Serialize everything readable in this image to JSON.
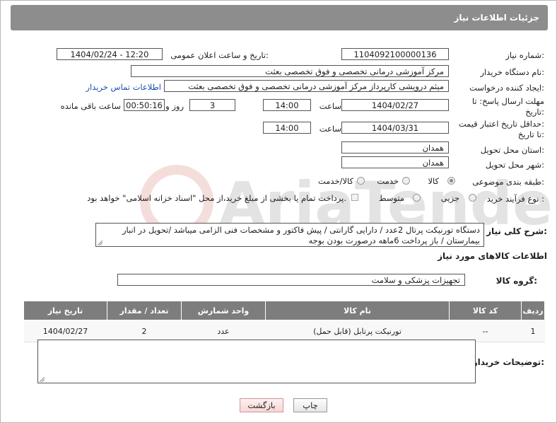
{
  "header": {
    "title": "جزئیات اطلاعات نیاز"
  },
  "fields": {
    "need_number_label": "شماره نیاز:",
    "need_number": "1104092100000136",
    "announce_label": "تاریخ و ساعت اعلان عمومی:",
    "announce_value": "1404/02/24 - 12:20",
    "buyer_org_label": "نام دستگاه خریدار:",
    "buyer_org": "مرکز آموزشی درمانی تخصصی و فوق تخصصی بعثت",
    "creator_label": "ایجاد کننده درخواست:",
    "creator": "میثم درویشی کارپرداز مرکز آموزشی درمانی تخصصی و فوق تخصصی بعثت",
    "contact_link": "اطلاعات تماس خریدار",
    "deadline_label_1": "مهلت ارسال پاسخ: تا",
    "deadline_label_2": "تاریخ:",
    "deadline_date": "1404/02/27",
    "time_label": "ساعت",
    "deadline_time": "14:00",
    "days_value": "3",
    "days_label": "روز و",
    "remaining_value": "00:50:16",
    "remaining_label": "ساعت باقی مانده",
    "price_validity_label_1": "حداقل تاریخ اعتبار قیمت:",
    "price_validity_label_2": "تا تاریخ:",
    "price_date": "1404/03/31",
    "price_time": "14:00",
    "province_label": "استان محل تحویل:",
    "province": "همدان",
    "city_label": "شهر محل تحویل:",
    "city": "همدان",
    "category_label": "طبقه بندی موضوعی:",
    "category_options": [
      "کالا",
      "خدمت",
      "کالا/خدمت"
    ],
    "process_label": "نوع فرآیند خرید :",
    "process_options": [
      "جزیی",
      "متوسط"
    ],
    "payment_note": "پرداخت تمام یا بخشی از مبلغ خرید،از محل \"اسناد خزانه اسلامی\" خواهد بود."
  },
  "description": {
    "label": "شرح کلی نیاز:",
    "text": "دستگاه تورنیکت پرتال 2عدد / دارایی گارانتی / پیش فاکتور و مشخصات فنی الزامی میباشد /تحویل در انبار بیمارستان / باز پرداخت 6ماهه درصورت بودن بوجه"
  },
  "goods": {
    "section_title": "اطلاعات کالاهای مورد نیاز",
    "group_label": "گروه کالا:",
    "group_value": "تجهیزات پزشکی و سلامت",
    "columns": [
      "ردیف",
      "کد کالا",
      "نام کالا",
      "واحد شمارش",
      "تعداد / مقدار",
      "تاریخ نیاز"
    ],
    "rows": [
      {
        "row": "1",
        "code": "--",
        "name": "تورنیکت پرتابل (قابل حمل)",
        "unit": "عدد",
        "qty": "2",
        "date": "1404/02/27"
      }
    ]
  },
  "buyer_notes": {
    "label": "توضیحات خریدار:",
    "text": ""
  },
  "buttons": {
    "print": "چاپ",
    "back": "بازگشت"
  },
  "watermark": {
    "text": "AriaTender.neT"
  }
}
